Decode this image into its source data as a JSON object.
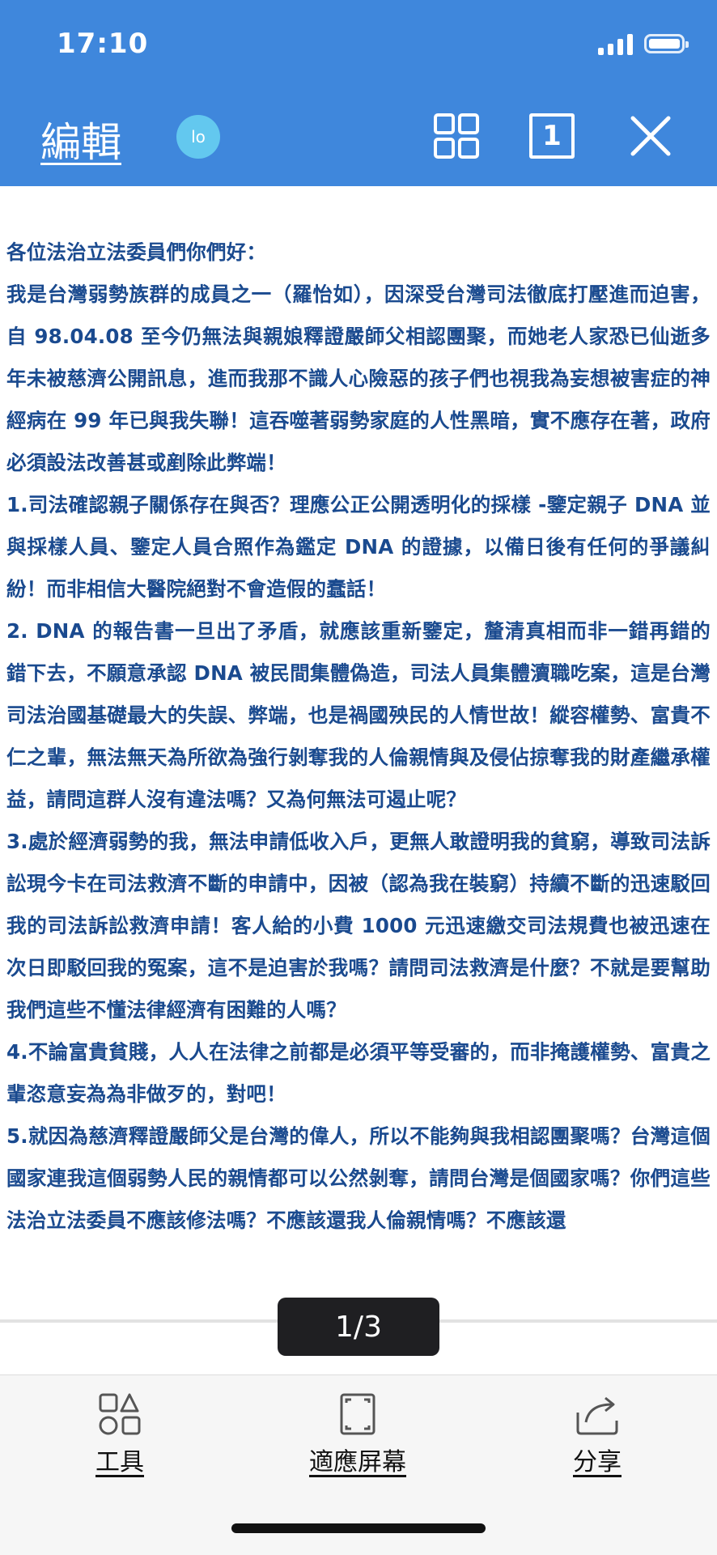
{
  "status": {
    "time": "17:10"
  },
  "toolbar": {
    "edit_label": "編輯",
    "avatar_initials": "lo",
    "page_icon_number": "1"
  },
  "document": {
    "paragraphs": [
      "各位法治立法委員們你們好：",
      "我是台灣弱勢族群的成員之一（羅怡如），因深受台灣司法徹底打壓進而迫害，自 98.04.08 至今仍無法與親娘釋證嚴師父相認團聚，而她老人家恐已仙逝多年未被慈濟公開訊息，進而我那不識人心險惡的孩子們也視我為妄想被害症的神經病在 99 年已與我失聯！這吞噬著弱勢家庭的人性黑暗，實不應存在著，政府必須設法改善甚或剷除此弊端！",
      "1.司法確認親子關係存在與否？理應公正公開透明化的採樣 -鑒定親子 DNA 並與採樣人員、鑒定人員合照作為鑑定 DNA 的證據，以備日後有任何的爭議糾紛！而非相信大醫院絕對不會造假的蠢話！",
      "2. DNA 的報告書一旦出了矛盾，就應該重新鑒定，釐清真相而非一錯再錯的錯下去，不願意承認 DNA 被民間集體偽造，司法人員集體瀆職吃案，這是台灣司法治國基礎最大的失誤、弊端，也是禍國殃民的人情世故！縱容權勢、富貴不仁之輩，無法無天為所欲為強行剝奪我的人倫親情與及侵佔掠奪我的財產繼承權益，請問這群人沒有違法嗎？又為何無法可遏止呢？",
      "3.處於經濟弱勢的我，無法申請低收入戶，更無人敢證明我的貧窮，導致司法訴訟現今卡在司法救濟不斷的申請中，因被（認為我在裝窮）持續不斷的迅速駁回我的司法訴訟救濟申請！客人給的小費 1000 元迅速繳交司法規費也被迅速在次日即駁回我的冤案，這不是迫害於我嗎？請問司法救濟是什麼？不就是要幫助我們這些不懂法律經濟有困難的人嗎？",
      "4.不論富貴貧賤，人人在法律之前都是必須平等受審的，而非掩護權勢、富貴之輩恣意妄為為非做歹的，對吧！",
      "5.就因為慈濟釋證嚴師父是台灣的偉人，所以不能夠與我相認團聚嗎？台灣這個國家連我這個弱勢人民的親情都可以公然剝奪，請問台灣是個國家嗎？你們這些法治立法委員不應該修法嗎？不應該還我人倫親情嗎？不應該還"
    ]
  },
  "pager": {
    "indicator": "1/3"
  },
  "bottom_bar": {
    "tools_label": "工具",
    "fit_label": "適應屏幕",
    "share_label": "分享"
  },
  "colors": {
    "topbar": "#3f87dc",
    "text": "#1a4a8f",
    "avatar": "#63c8ef"
  },
  "icons": [
    "signal-icon",
    "battery-icon",
    "grid-view-icon",
    "page-number-icon",
    "close-icon",
    "tools-icon",
    "fit-screen-icon",
    "share-icon"
  ]
}
